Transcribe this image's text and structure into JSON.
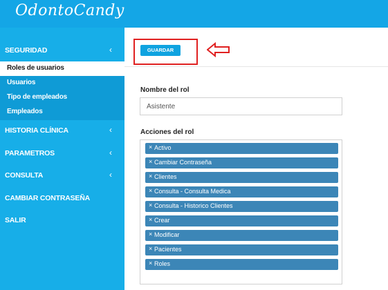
{
  "app": {
    "logo": "OdontoCandy"
  },
  "sidebar": {
    "sections": [
      {
        "label": "SEGURIDAD",
        "chevron": "‹"
      },
      {
        "label": "HISTORIA CLÍNICA",
        "chevron": "‹"
      },
      {
        "label": "PARAMETROS",
        "chevron": "‹"
      },
      {
        "label": "CONSULTA",
        "chevron": "‹"
      },
      {
        "label": "CAMBIAR CONTRASEÑA"
      },
      {
        "label": "SALIR"
      }
    ],
    "submenu": [
      {
        "label": "Roles de usuarios",
        "active": true
      },
      {
        "label": "Usuarios"
      },
      {
        "label": "Tipo de empleados"
      },
      {
        "label": "Empleados"
      }
    ]
  },
  "toolbar": {
    "save_label": "GUARDAR"
  },
  "form": {
    "role_name_label": "Nombre del rol",
    "role_name_value": "Asistente",
    "actions_label": "Acciones del rol",
    "actions": [
      "Activo",
      "Cambiar Contraseña",
      "Clientes",
      "Consulta - Consulta Medica",
      "Consulta - Historico Clientes",
      "Crear",
      "Modificar",
      "Pacientes",
      "Roles"
    ],
    "chip_remove_glyph": "×"
  },
  "colors": {
    "topbar": "#14a6e6",
    "sidebar": "#17aee8",
    "submenu": "#0f9bd6",
    "save_button": "#0fa3e0",
    "chip": "#3c86b7",
    "annotation": "#e02020"
  }
}
